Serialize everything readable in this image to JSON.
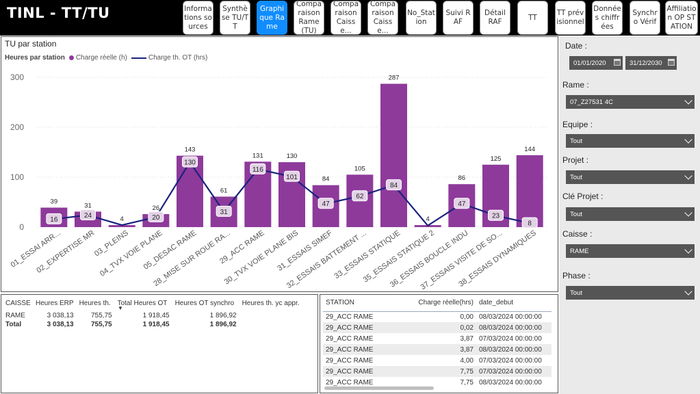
{
  "app": {
    "title": "TINL - TT/TU"
  },
  "nav": {
    "tabs": [
      {
        "label": "Informations sources",
        "active": false
      },
      {
        "label": "Synthèse TU/TT",
        "active": false
      },
      {
        "label": "Graphique Rame",
        "active": true
      },
      {
        "label": "Comparaison Rame (TU)",
        "active": false
      },
      {
        "label": "Comparaison Caisse...",
        "active": false
      },
      {
        "label": "Comparaison Caisse...",
        "active": false
      },
      {
        "label": "No_Station",
        "active": false
      },
      {
        "label": "Suivi RAF",
        "active": false
      },
      {
        "label": "Détail RAF",
        "active": false
      },
      {
        "label": "TT",
        "active": false
      },
      {
        "label": "TT prévisionnel",
        "active": false
      },
      {
        "label": "Données chiffrées",
        "active": false
      },
      {
        "label": "Synchro Vérif",
        "active": false
      },
      {
        "label": "Affiliation OP STATION",
        "active": false
      }
    ]
  },
  "chart": {
    "title": "TU par station",
    "legend_title": "Heures par station",
    "legend_bar": "Charge réelle (h)",
    "legend_line": "Charge th. OT (hrs)"
  },
  "chart_data": {
    "type": "bar",
    "categories": [
      "01_ESSAI ARR...",
      "02_EXPERTISE MR",
      "03_PLEINS",
      "04_TVX VOIE PLANE",
      "05_DESAC RAME",
      "28_MISE SUR ROUE RA...",
      "29_ACC RAME",
      "30_TVX VOIE PLANE BIS",
      "31_ESSAIS SIMEF",
      "32_ESSAIS BATTEMENT ...",
      "33_ESSAIS STATIQUE",
      "35_ESSAIS STATIQUE 2",
      "36_ESSAIS BOUCLE INDU",
      "37_ESSAIS VISITE DE SO...",
      "38_ESSAIS DYNAMIQUES"
    ],
    "series": [
      {
        "name": "Charge réelle (h)",
        "type": "bar",
        "color": "#8e3a9b",
        "values": [
          39,
          31,
          4,
          26,
          143,
          61,
          131,
          130,
          84,
          105,
          287,
          4,
          86,
          125,
          144
        ]
      },
      {
        "name": "Charge th. OT (hrs)",
        "type": "line",
        "color": "#1a237e",
        "values": [
          16,
          24,
          4,
          20,
          130,
          31,
          116,
          101,
          47,
          62,
          84,
          3,
          47,
          23,
          8
        ]
      }
    ],
    "line_labels_visible": [
      true,
      true,
      false,
      true,
      true,
      true,
      true,
      true,
      true,
      true,
      true,
      false,
      true,
      true,
      true
    ],
    "yticks": [
      0,
      100,
      200,
      300
    ],
    "ylim": [
      0,
      320
    ],
    "grid": true,
    "legend_position": "top-left"
  },
  "table1": {
    "headers": [
      "CAISSE",
      "Heures ERP",
      "Heures th.",
      "Total Heures OT",
      "Heures OT synchro",
      "Heures th. yc appr."
    ],
    "rows": [
      [
        "RAME",
        "3 038,13",
        "755,75",
        "1 918,45",
        "1 896,92",
        ""
      ]
    ],
    "total": [
      "Total",
      "3 038,13",
      "755,75",
      "1 918,45",
      "1 896,92",
      ""
    ],
    "sort_glyph": "▼"
  },
  "table2": {
    "headers": [
      "STATION",
      "Charge réelle(hrs)",
      "date_debut"
    ],
    "rows": [
      [
        "29_ACC RAME",
        "0,00",
        "08/03/2024 00:00:00"
      ],
      [
        "29_ACC RAME",
        "0,02",
        "08/03/2024 00:00:00"
      ],
      [
        "29_ACC RAME",
        "3,87",
        "07/03/2024 00:00:00"
      ],
      [
        "29_ACC RAME",
        "3,87",
        "08/03/2024 00:00:00"
      ],
      [
        "29_ACC RAME",
        "4,00",
        "07/03/2024 00:00:00"
      ],
      [
        "29_ACC RAME",
        "7,75",
        "07/03/2024 00:00:00"
      ],
      [
        "29_ACC RAME",
        "7,75",
        "08/03/2024 00:00:00"
      ]
    ]
  },
  "filters": {
    "date_label": "Date :",
    "date_start": "01/01/2020",
    "date_end": "31/12/2030",
    "rame_label": "Rame :",
    "rame_value": "07_Z27531 4C",
    "equipe_label": "Equipe :",
    "equipe_value": "Tout",
    "projet_label": "Projet :",
    "projet_value": "Tout",
    "cle_projet_label": "Clé Projet :",
    "cle_projet_value": "Tout",
    "caisse_label": "Caisse :",
    "caisse_value": "RAME",
    "phase_label": "Phase :",
    "phase_value": "Tout"
  }
}
